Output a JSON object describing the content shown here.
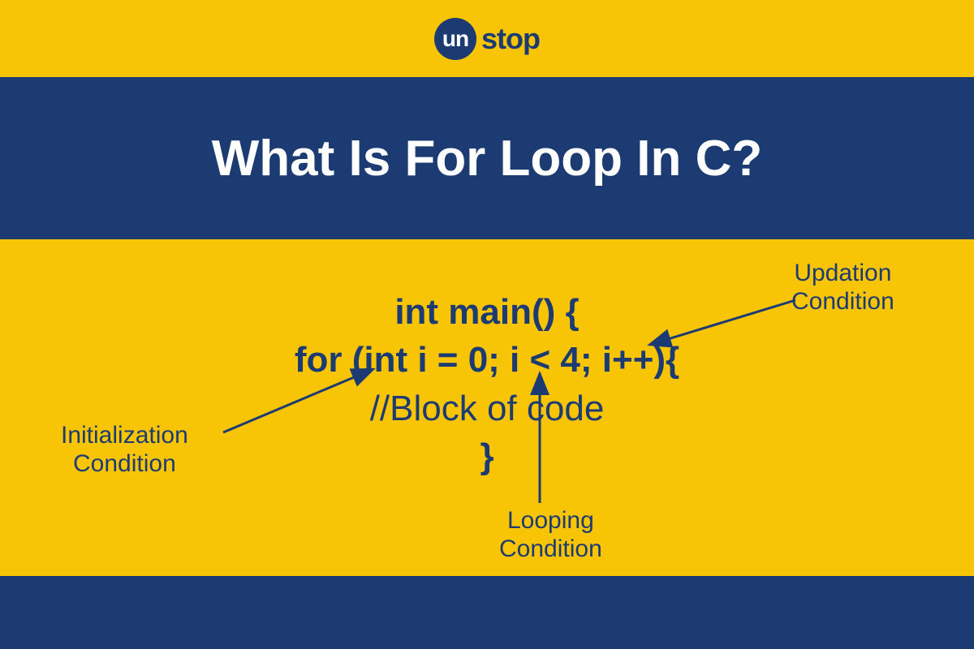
{
  "brand": {
    "badge": "un",
    "text": "stop"
  },
  "title": "What Is For Loop In C?",
  "code": {
    "line1": "int main() {",
    "line2": "for (int i = 0; i < 4; i++){",
    "line3": "//Block of code",
    "line4": "}"
  },
  "annotations": {
    "initialization": "Initialization\nCondition",
    "looping": "Looping\nCondition",
    "updation": "Updation\nCondition"
  },
  "colors": {
    "yellow": "#f7c506",
    "navy": "#1d3b73",
    "white": "#ffffff"
  }
}
